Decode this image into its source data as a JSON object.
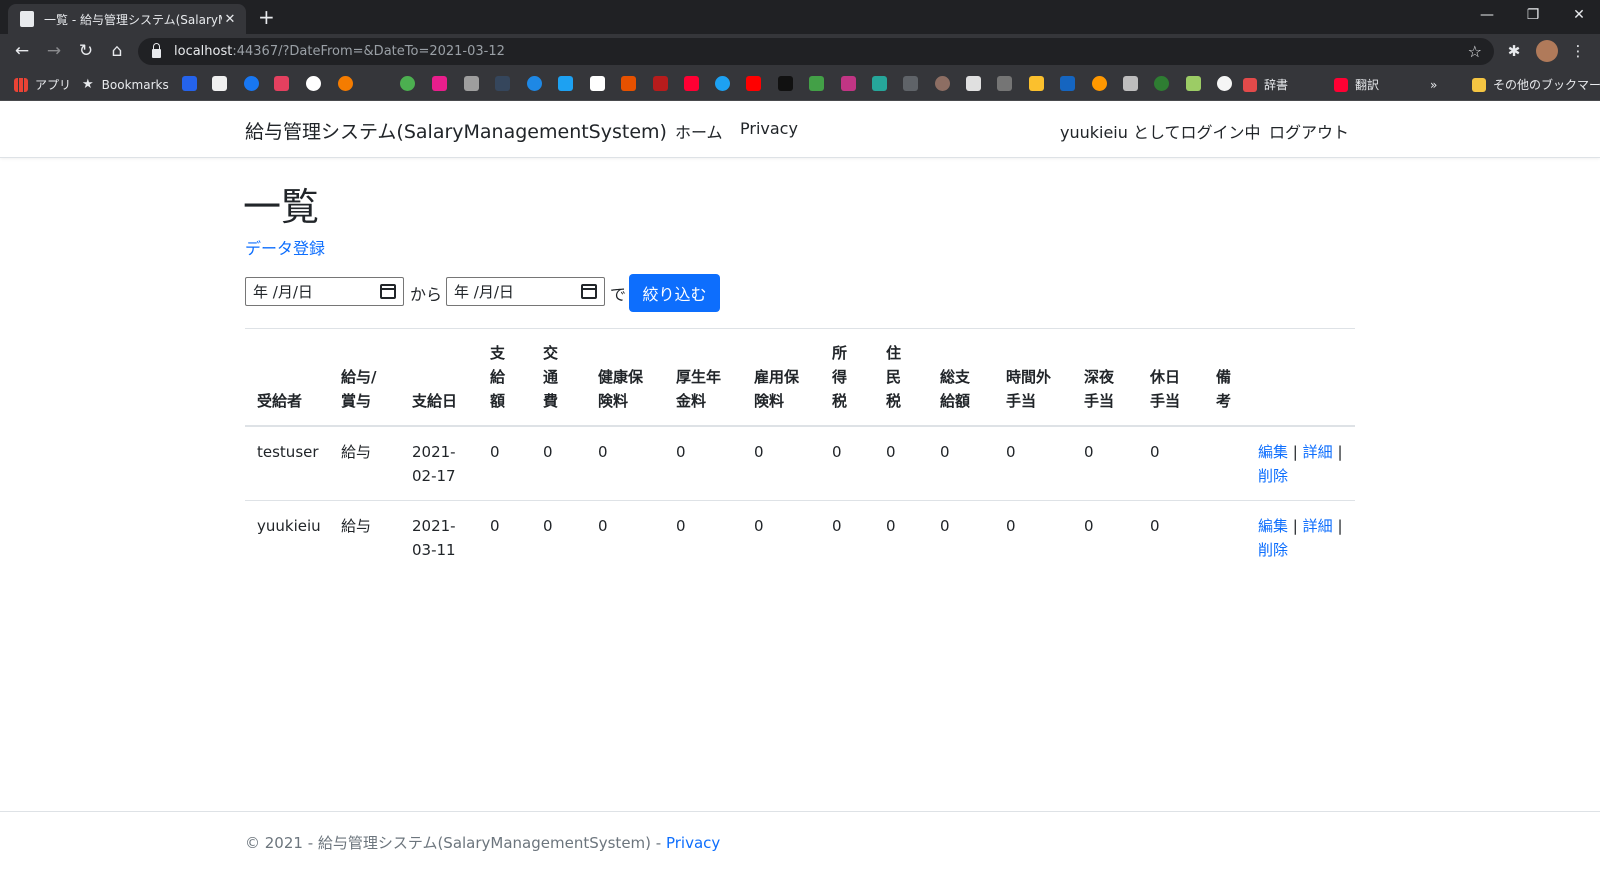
{
  "browser": {
    "tab_title": "一覧 - 給与管理システム(SalaryMa",
    "tab_close": "✕",
    "new_tab": "+",
    "url_host": "localhost",
    "url_rest": ":44367/?DateFrom=&DateTo=2021-03-12",
    "window_controls": {
      "minimize": "—",
      "restore": "❐",
      "close": "✕"
    },
    "bookmarks": [
      {
        "label": "アプリ",
        "icon": "apps-grid-icon"
      },
      {
        "label": "Bookmarks",
        "icon": "star-icon"
      },
      {
        "label": "辞書",
        "icon": "dictionary-icon"
      },
      {
        "label": "翻訳",
        "icon": "yahoo-icon"
      },
      {
        "label": "その他のブックマーク",
        "icon": "folder-icon"
      }
    ],
    "more_bookmarks": "»",
    "colors": {
      "tabbar": "#202124",
      "toolbar": "#35363a"
    }
  },
  "nav": {
    "brand": "給与管理システム(SalaryManagementSystem)",
    "home": "ホーム",
    "privacy": "Privacy",
    "login_status": "yuukieiu としてログイン中",
    "logout": "ログアウト"
  },
  "main": {
    "title": "一覧",
    "create_link": "データ登録",
    "filter": {
      "from_placeholder": "年 /月/日",
      "from_sep": "から",
      "to_placeholder": "年 /月/日",
      "to_sep": "で",
      "submit": "絞り込む"
    },
    "table": {
      "headers": [
        "受給者",
        "給与/ 賞与",
        "支給日",
        "支 給 額",
        "交 通 費",
        "健康保 険料",
        "厚生年 金料",
        "雇用保 険料",
        "所 得 税",
        "住 民 税",
        "総支 給額",
        "時間外 手当",
        "深夜 手当",
        "休日 手当",
        "備 考"
      ],
      "rows": [
        {
          "recipient": "testuser",
          "type": "給与",
          "date_year": "2021-",
          "date_md": "02-17",
          "values": [
            "0",
            "0",
            "0",
            "0",
            "0",
            "0",
            "0",
            "0",
            "0",
            "0",
            "0"
          ],
          "note": "",
          "edit": "編集",
          "detail": "詳細",
          "delete": "削除"
        },
        {
          "recipient": "yuukieiu",
          "type": "給与",
          "date_year": "2021-",
          "date_md": "03-11",
          "values": [
            "0",
            "0",
            "0",
            "0",
            "0",
            "0",
            "0",
            "0",
            "0",
            "0",
            "0"
          ],
          "note": "",
          "edit": "編集",
          "detail": "詳細",
          "delete": "削除"
        }
      ],
      "action_sep": "|"
    },
    "colors": {
      "link": "#0d6efd",
      "primary_button": "#0d6efd"
    }
  },
  "footer": {
    "text": "© 2021 - 給与管理システム(SalaryManagementSystem) - ",
    "privacy": "Privacy"
  }
}
